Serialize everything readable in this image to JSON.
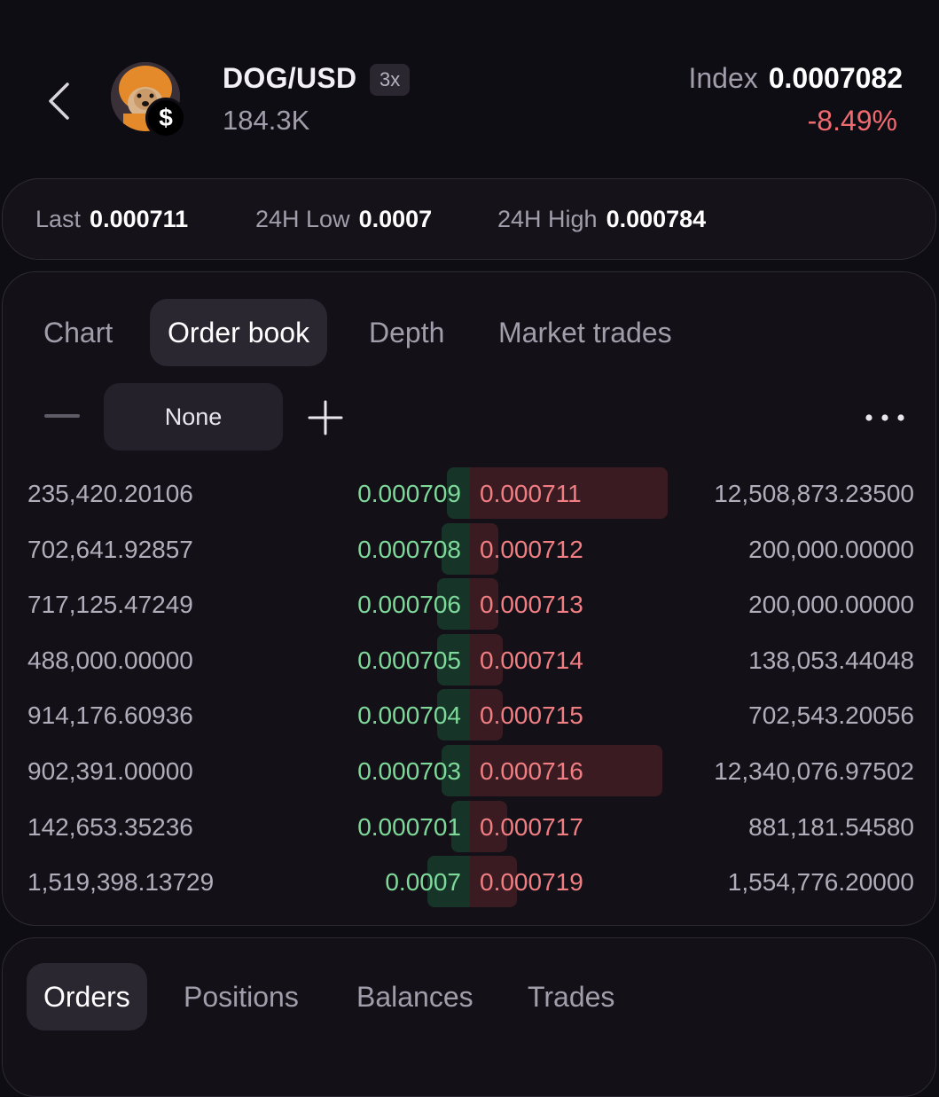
{
  "header": {
    "pair": "DOG/USD",
    "leverage": "3x",
    "volume": "184.3K",
    "index_label": "Index",
    "index_value": "0.0007082",
    "change": "-8.49%",
    "badge_symbol": "$"
  },
  "stats": {
    "last_label": "Last",
    "last_value": "0.000711",
    "low_label": "24H Low",
    "low_value": "0.0007",
    "high_label": "24H High",
    "high_value": "0.000784"
  },
  "tabs": [
    "Chart",
    "Order book",
    "Depth",
    "Market trades"
  ],
  "active_tab": "Order book",
  "controls": {
    "precision": "None"
  },
  "order_book": {
    "bids": [
      {
        "amount": "235,420.20106",
        "price": "0.000709",
        "depth": 0.05
      },
      {
        "amount": "702,641.92857",
        "price": "0.000708",
        "depth": 0.06
      },
      {
        "amount": "717,125.47249",
        "price": "0.000706",
        "depth": 0.07
      },
      {
        "amount": "488,000.00000",
        "price": "0.000705",
        "depth": 0.07
      },
      {
        "amount": "914,176.60936",
        "price": "0.000704",
        "depth": 0.07
      },
      {
        "amount": "902,391.00000",
        "price": "0.000703",
        "depth": 0.06
      },
      {
        "amount": "142,653.35236",
        "price": "0.000701",
        "depth": 0.04
      },
      {
        "amount": "1,519,398.13729",
        "price": "0.0007",
        "depth": 0.09
      }
    ],
    "asks": [
      {
        "price": "0.000711",
        "amount": "12,508,873.23500",
        "depth": 0.42
      },
      {
        "price": "0.000712",
        "amount": "200,000.00000",
        "depth": 0.06
      },
      {
        "price": "0.000713",
        "amount": "200,000.00000",
        "depth": 0.06
      },
      {
        "price": "0.000714",
        "amount": "138,053.44048",
        "depth": 0.07
      },
      {
        "price": "0.000715",
        "amount": "702,543.20056",
        "depth": 0.07
      },
      {
        "price": "0.000716",
        "amount": "12,340,076.97502",
        "depth": 0.41
      },
      {
        "price": "0.000717",
        "amount": "881,181.54580",
        "depth": 0.08
      },
      {
        "price": "0.000719",
        "amount": "1,554,776.20000",
        "depth": 0.1
      }
    ]
  },
  "bottom_tabs": [
    "Orders",
    "Positions",
    "Balances",
    "Trades"
  ],
  "active_bottom_tab": "Orders",
  "colors": {
    "background": "#0f0d14",
    "bid_green": "#7ed99a",
    "ask_red": "#f07e82",
    "bid_bar": "#163528",
    "ask_bar": "#3a1b22"
  }
}
